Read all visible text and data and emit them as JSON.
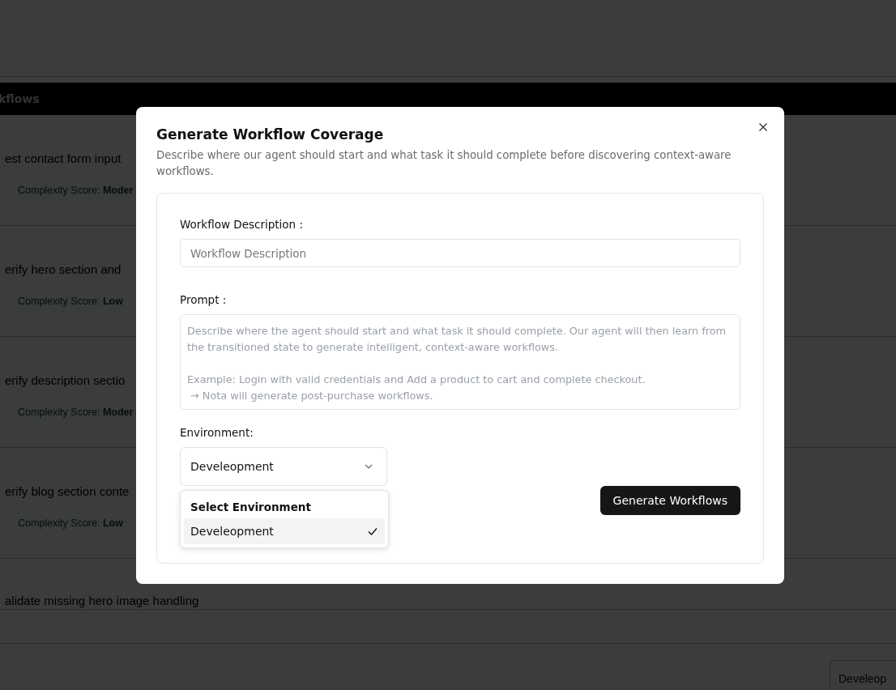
{
  "background": {
    "header": "kflows",
    "workflows": [
      {
        "title": "est contact form input",
        "score": "Complexity Score: **Moder**"
      },
      {
        "title": "erify hero section and",
        "score": "Complexity Score: **Low**"
      },
      {
        "title": "erify description sectio",
        "score": "Complexity Score: **Moder**"
      },
      {
        "title": "erify blog section conte",
        "score": "Complexity Score: **Low**"
      }
    ],
    "last_title": "alidate missing hero image handling",
    "corner_select": "Develeop"
  },
  "dialog": {
    "title": "Generate Workflow Coverage",
    "description": "Describe where our agent should start and what task it should complete before discovering context-aware workflows.",
    "workflow_description": {
      "label": "Workflow Description :",
      "placeholder": "Workflow Description"
    },
    "prompt": {
      "label": "Prompt :",
      "placeholder": "Describe where the agent should start and what task it should complete. Our agent will then learn from the transitioned state to generate intelligent, context-aware workflows.\n\nExample: Login with valid credentials and Add a product to cart and complete checkout.\n → Nota will generate post-purchase workflows."
    },
    "environment": {
      "label": "Environment:",
      "value": "Develeopment",
      "expanded": true,
      "menu_heading": "Select Environment",
      "options": [
        {
          "label": "Develeopment",
          "selected": true
        }
      ]
    },
    "submit": "Generate Workflows"
  }
}
